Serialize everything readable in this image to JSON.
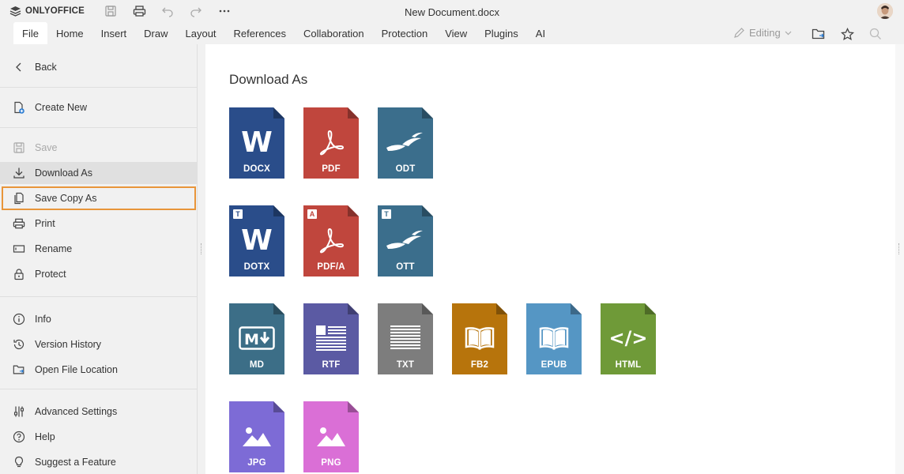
{
  "app": {
    "brand": "ONLYOFFICE",
    "document_title": "New Document.docx"
  },
  "tabs": [
    "File",
    "Home",
    "Insert",
    "Draw",
    "Layout",
    "References",
    "Collaboration",
    "Protection",
    "View",
    "Plugins",
    "AI"
  ],
  "toolbar": {
    "editing_label": "Editing"
  },
  "sidebar": {
    "back": "Back",
    "create_new": "Create New",
    "save": "Save",
    "download_as": "Download As",
    "save_copy_as": "Save Copy As",
    "print": "Print",
    "rename": "Rename",
    "protect": "Protect",
    "info": "Info",
    "version_history": "Version History",
    "open_file_location": "Open File Location",
    "advanced_settings": "Advanced Settings",
    "help": "Help",
    "suggest_feature": "Suggest a Feature"
  },
  "content": {
    "title": "Download As",
    "formats": {
      "docx": "DOCX",
      "pdf": "PDF",
      "odt": "ODT",
      "dotx": "DOTX",
      "pdfa": "PDF/A",
      "ott": "OTT",
      "md": "MD",
      "rtf": "RTF",
      "txt": "TXT",
      "fb2": "FB2",
      "epub": "EPUB",
      "html": "HTML",
      "jpg": "JPG",
      "png": "PNG"
    },
    "badges": {
      "template": "T",
      "archive": "A"
    },
    "glyph_text": {
      "word": "W",
      "md_m": "M",
      "html": "</>"
    }
  },
  "colors": {
    "docx": "#2a4d8a",
    "pdf": "#c0463d",
    "odt": "#3b6e8c",
    "md": "#3c6e87",
    "rtf": "#5b5aa3",
    "txt": "#7d7d7d",
    "fb2": "#b7740c",
    "epub": "#5596c4",
    "html": "#6f9a38",
    "jpg": "#7d6bd6",
    "png": "#da6fd6",
    "highlight": "#e8953a"
  }
}
